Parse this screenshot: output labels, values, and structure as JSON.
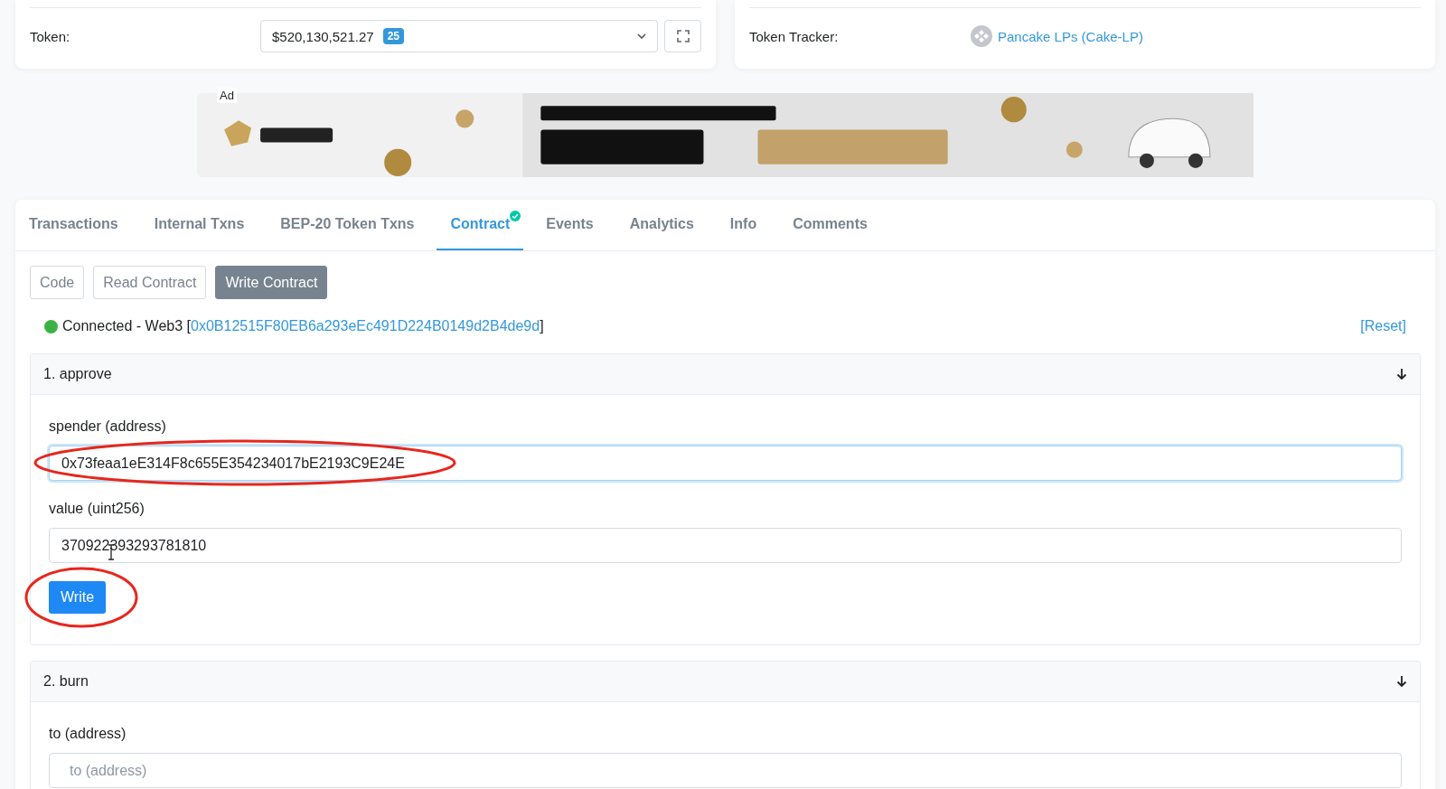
{
  "overview_left": {
    "label": "Token:",
    "value": "$520,130,521.27",
    "badge": "25"
  },
  "overview_right": {
    "label": "Token Tracker:",
    "link": "Pancake LPs (Cake-LP)"
  },
  "ad": {
    "label": "Ad",
    "kind": "picture"
  },
  "tabs": [
    {
      "label": "Transactions",
      "selected": false,
      "verified": false
    },
    {
      "label": "Internal Txns",
      "selected": false,
      "verified": false
    },
    {
      "label": "BEP-20 Token Txns",
      "selected": false,
      "verified": false
    },
    {
      "label": "Contract",
      "selected": true,
      "verified": true
    },
    {
      "label": "Events",
      "selected": false,
      "verified": false
    },
    {
      "label": "Analytics",
      "selected": false,
      "verified": false
    },
    {
      "label": "Info",
      "selected": false,
      "verified": false
    },
    {
      "label": "Comments",
      "selected": false,
      "verified": false
    }
  ],
  "subtabs": [
    {
      "label": "Code",
      "selected": false
    },
    {
      "label": "Read Contract",
      "selected": false
    },
    {
      "label": "Write Contract",
      "selected": true
    }
  ],
  "connection": {
    "connected": true,
    "status": "Connected - Web3 [",
    "address": "0x0B12515F80EB6a293eEc491D224B0149d2B4de9d",
    "close": "]",
    "reset": "[Reset]"
  },
  "functions": [
    {
      "title": "1. approve",
      "expanded": true,
      "inputs": [
        {
          "label": "spender (address)",
          "value": "0x73feaa1eE314F8c655E354234017bE2193C9E24E",
          "focused": true,
          "circled": true
        },
        {
          "label": "value (uint256)",
          "value": "370922393293781810",
          "focused": false,
          "circled": false
        }
      ],
      "button": "Write",
      "button_circled": true
    },
    {
      "title": "2. burn",
      "expanded": true,
      "inputs": [
        {
          "label": "to (address)",
          "placeholder": "to (address)",
          "focused": false,
          "circled": false
        }
      ]
    }
  ]
}
